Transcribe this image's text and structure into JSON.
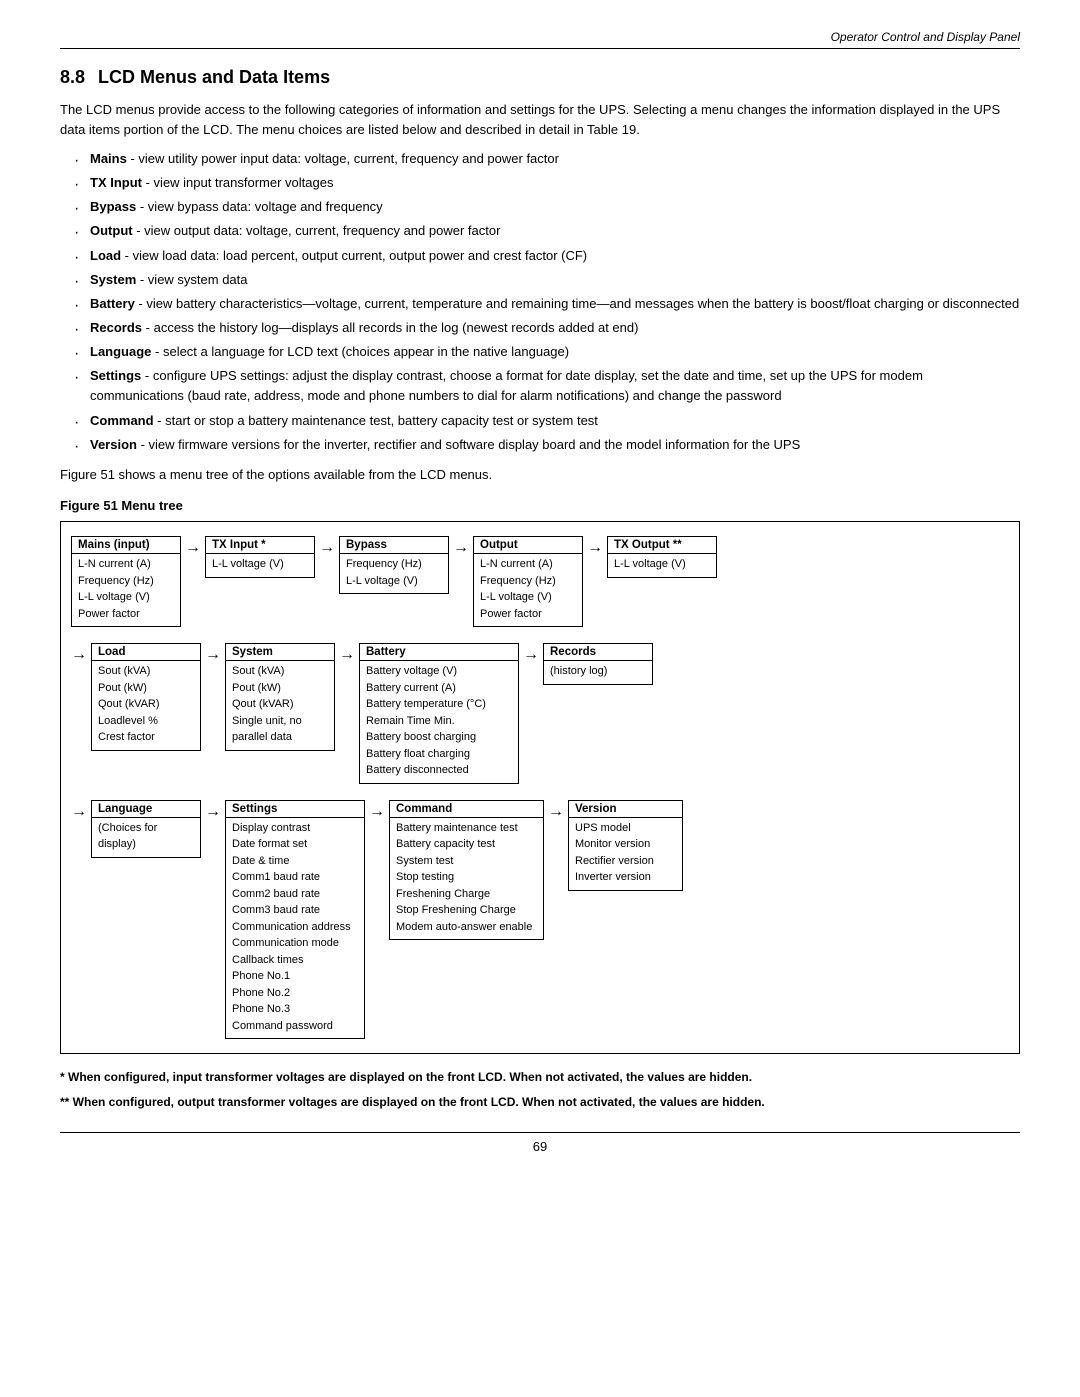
{
  "header": {
    "right_text": "Operator Control and Display Panel"
  },
  "section": {
    "number": "8.8",
    "title": "LCD Menus and Data Items"
  },
  "intro": {
    "paragraph": "The LCD menus provide access to the following categories of information and settings for the UPS. Selecting a menu changes the information displayed in the UPS data items portion of the LCD. The menu choices are listed below and described in detail in Table 19."
  },
  "bullets": [
    {
      "term": "Mains",
      "text": " - view utility power input data: voltage, current, frequency and power factor"
    },
    {
      "term": "TX Input",
      "text": " - view input transformer voltages"
    },
    {
      "term": "Bypass",
      "text": " - view bypass data: voltage and frequency"
    },
    {
      "term": "Output",
      "text": " - view output data: voltage, current, frequency and power factor"
    },
    {
      "term": "Load",
      "text": " - view load data: load percent, output current, output power and crest factor (CF)"
    },
    {
      "term": "System",
      "text": " - view system data"
    },
    {
      "term": "Battery",
      "text": " - view battery characteristics—voltage, current, temperature and remaining time—and messages when the battery is boost/float charging or disconnected"
    },
    {
      "term": "Records",
      "text": " - access the history log—displays all records in the log (newest records added at end)"
    },
    {
      "term": "Language",
      "text": " - select a language for LCD text (choices appear in the native language)"
    },
    {
      "term": "Settings",
      "text": " - configure UPS settings: adjust the display contrast, choose a format for date display, set the date and time, set up the UPS for modem communications (baud rate, address, mode and phone numbers to dial for alarm notifications) and change the password"
    },
    {
      "term": "Command",
      "text": " - start or stop a battery maintenance test, battery capacity test or system test"
    },
    {
      "term": "Version",
      "text": " - view firmware versions for the inverter, rectifier and software display board and the model information for the UPS"
    }
  ],
  "figure_intro": "Figure 51 shows a menu tree of the options available from the LCD menus.",
  "figure_caption": "Figure 51  Menu tree",
  "tree": {
    "row1": {
      "mains_input": {
        "header": "Mains (input)",
        "items": [
          "L-N current (A)",
          "Frequency (Hz)",
          "L-L voltage (V)",
          "Power factor"
        ]
      },
      "tx_input": {
        "header": "TX Input *",
        "items": [
          "L-L voltage (V)"
        ]
      },
      "bypass": {
        "header": "Bypass",
        "items": [
          "Frequency (Hz)",
          "L-L voltage (V)"
        ]
      },
      "output": {
        "header": "Output",
        "items": [
          "L-N current (A)",
          "Frequency (Hz)",
          "L-L voltage (V)",
          "Power factor"
        ]
      },
      "tx_output": {
        "header": "TX Output **",
        "items": [
          "L-L voltage (V)"
        ]
      }
    },
    "row2": {
      "load": {
        "header": "Load",
        "items": [
          "Sout (kVA)",
          "Pout (kW)",
          "Qout (kVAR)",
          "Loadlevel %",
          "Crest factor"
        ]
      },
      "system": {
        "header": "System",
        "items": [
          "Sout (kVA)",
          "Pout (kW)",
          "Qout (kVAR)",
          "Single unit, no",
          "parallel data"
        ]
      },
      "battery": {
        "header": "Battery",
        "items": [
          "Battery voltage (V)",
          "Battery current (A)",
          "Battery temperature (°C)",
          "Remain Time Min.",
          "Battery boost charging",
          "Battery float charging",
          "Battery disconnected"
        ]
      },
      "records": {
        "header": "Records",
        "items": [
          "(history log)"
        ]
      }
    },
    "row3": {
      "language": {
        "header": "Language",
        "items": [
          "(Choices for",
          "display)"
        ]
      },
      "settings": {
        "header": "Settings",
        "items": [
          "Display contrast",
          "Date format set",
          "Date & time",
          "Comm1 baud rate",
          "Comm2 baud rate",
          "Comm3 baud rate",
          "Communication address",
          "Communication mode",
          "Callback times",
          "Phone No.1",
          "Phone No.2",
          "Phone No.3",
          "Command password"
        ]
      },
      "command": {
        "header": "Command",
        "items": [
          "Battery maintenance test",
          "Battery capacity test",
          "System test",
          "Stop testing",
          "Freshening Charge",
          "Stop Freshening Charge",
          "Modem auto-answer enable"
        ]
      },
      "version": {
        "header": "Version",
        "items": [
          "UPS model",
          "Monitor version",
          "Rectifier version",
          "Inverter version"
        ]
      }
    }
  },
  "footnotes": {
    "star1": "*  When configured, input transformer voltages are displayed on the front LCD. When not activated, the values are hidden.",
    "star2": "** When configured, output transformer voltages are displayed on the front LCD. When not activated, the values are hidden."
  },
  "page_number": "69"
}
